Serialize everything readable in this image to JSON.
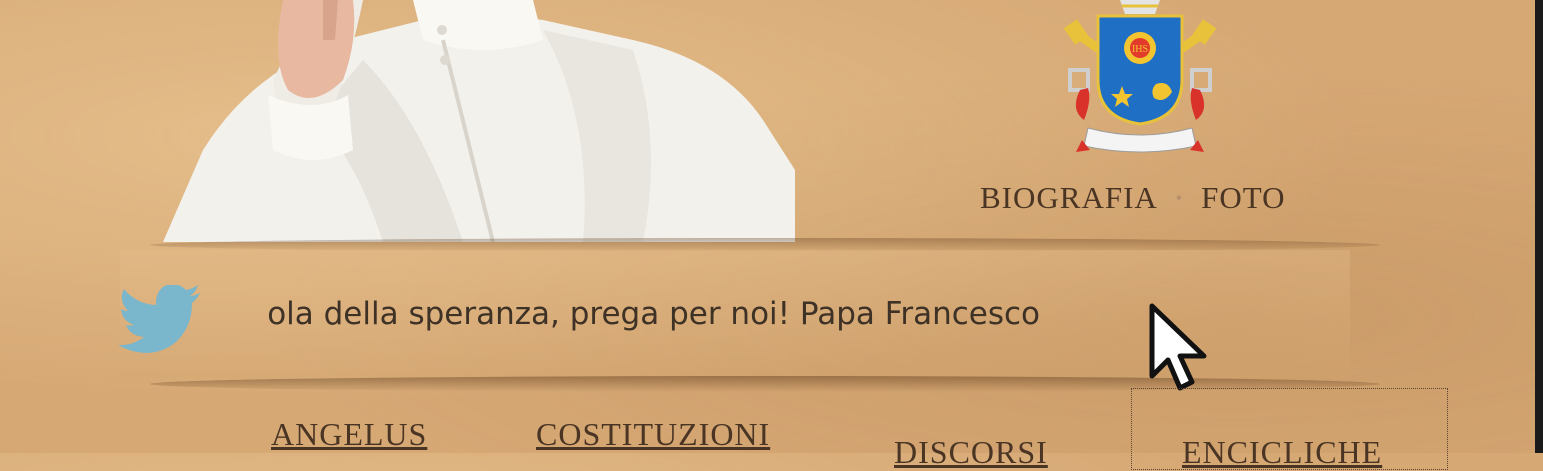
{
  "header": {
    "nav_items": [
      {
        "label": "BIOGRAFIA"
      },
      {
        "label": "FOTO"
      }
    ],
    "separator": "•"
  },
  "twitter": {
    "icon": "twitter-bird-icon",
    "ticker_text": "ola della speranza, prega per noi! Papa Francesco"
  },
  "main_nav": {
    "items": [
      {
        "label": "ANGELUS"
      },
      {
        "label": "COSTITUZIONI"
      },
      {
        "label": "DISCORSI"
      },
      {
        "label": "ENCICLICHE"
      }
    ]
  },
  "colors": {
    "background": "#d6a874",
    "text": "#4a3524",
    "twitter_blue": "#7ab6cc",
    "shield_blue": "#1f6fc4"
  }
}
